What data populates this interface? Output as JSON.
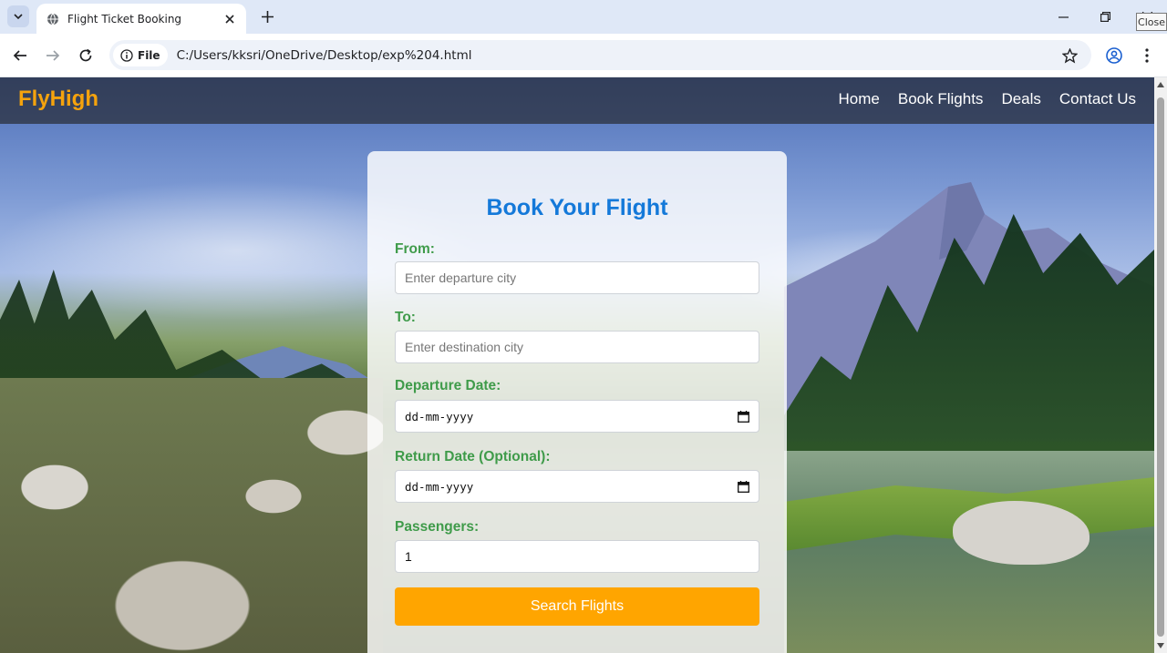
{
  "browser": {
    "tab": {
      "title": "Flight Ticket Booking"
    },
    "url": "C:/Users/kksri/OneDrive/Desktop/exp%204.html",
    "site_chip": "File",
    "tooltip": "Close"
  },
  "site": {
    "brand": "FlyHigh",
    "nav": [
      "Home",
      "Book Flights",
      "Deals",
      "Contact Us"
    ],
    "accent_color": "#f5a30d",
    "title_color": "#1479d9",
    "label_color": "#3f9b4a"
  },
  "form": {
    "title": "Book Your Flight",
    "from": {
      "label": "From:",
      "placeholder": "Enter departure city"
    },
    "to": {
      "label": "To:",
      "placeholder": "Enter destination city"
    },
    "departure": {
      "label": "Departure Date:",
      "value": "dd-mm-yyyy"
    },
    "return": {
      "label": "Return Date (Optional):",
      "value": "dd-mm-yyyy"
    },
    "passengers": {
      "label": "Passengers:",
      "value": "1"
    },
    "submit_label": "Search Flights"
  }
}
